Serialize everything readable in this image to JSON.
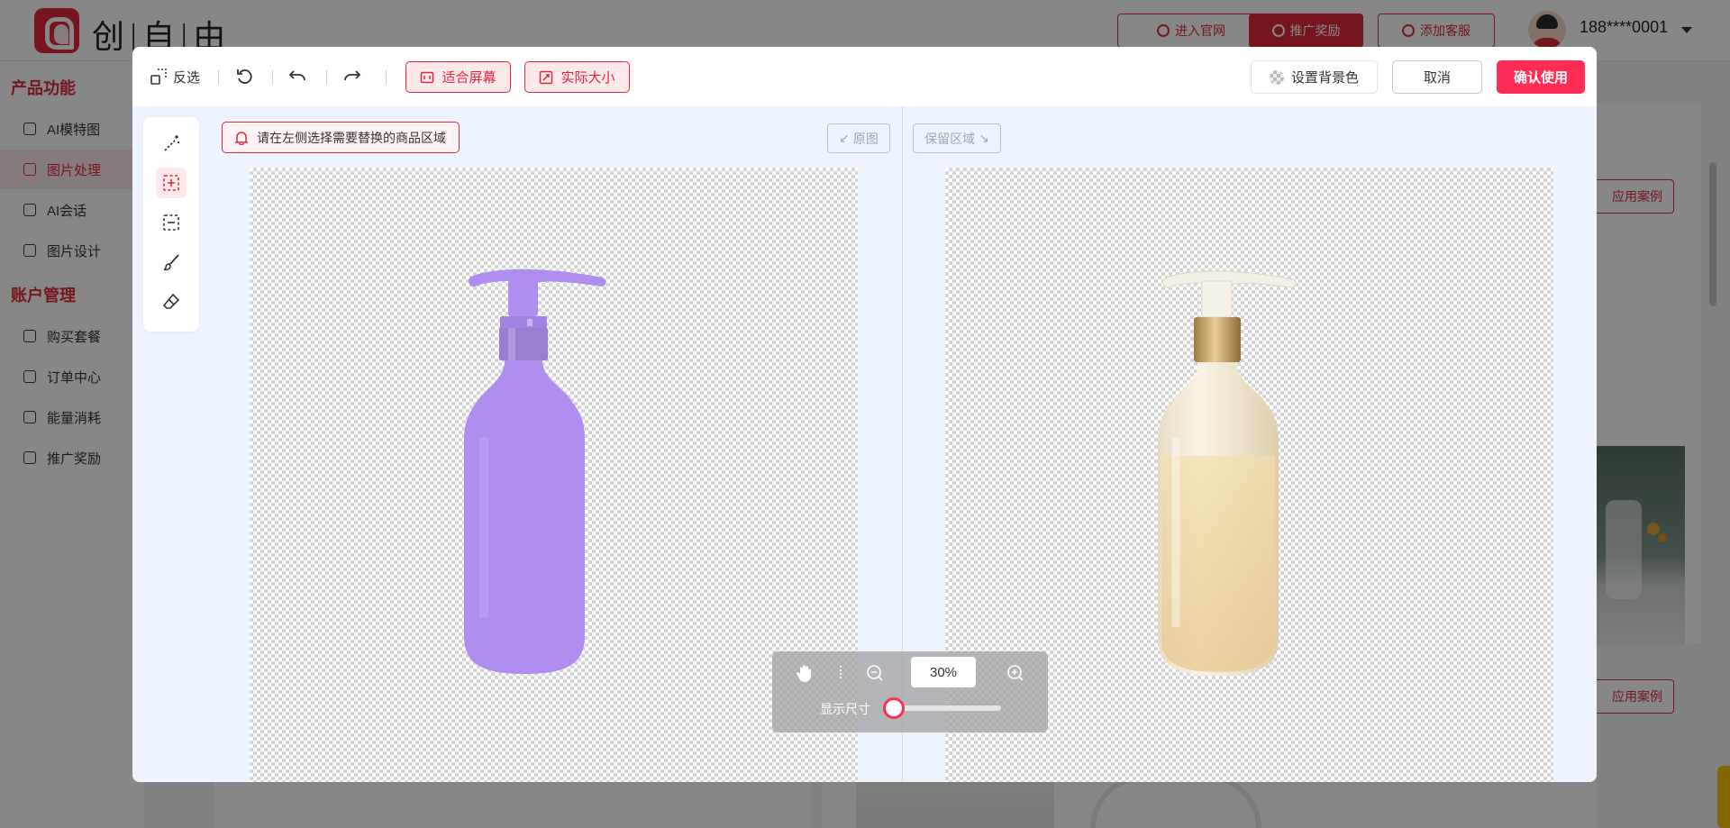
{
  "app": {
    "brand": "创|自|由",
    "header_buttons": [
      {
        "label": "进入官网"
      },
      {
        "label": "推广奖励"
      },
      {
        "label": "添加客服"
      }
    ],
    "user": "188****0001"
  },
  "sidebar": {
    "group1": "产品功能",
    "group1_items": [
      {
        "label": "AI模特图"
      },
      {
        "label": "图片处理"
      },
      {
        "label": "AI会话"
      },
      {
        "label": "图片设计"
      }
    ],
    "group2": "账户管理",
    "group2_items": [
      {
        "label": "购买套餐"
      },
      {
        "label": "订单中心"
      },
      {
        "label": "能量消耗"
      },
      {
        "label": "推广奖励"
      }
    ]
  },
  "page": {
    "case_button": "应用案例"
  },
  "modal": {
    "toolbar": {
      "invert": "反选",
      "fit_screen": "适合屏幕",
      "actual_size": "实际大小",
      "set_bg": "设置背景色",
      "cancel": "取消",
      "confirm": "确认使用"
    },
    "hint": "请在左侧选择需要替换的商品区域",
    "original": "原图",
    "keep_area": "保留区域",
    "zoom": {
      "value": "30%",
      "size_label": "显示尺寸",
      "display_size_level": 0
    },
    "colors": {
      "accent": "#e0283c",
      "confirm": "#ff2d55",
      "mask": "#b08ef0",
      "cap_gold": "#c9a46c",
      "bottle_cream": "#eee0c6"
    }
  }
}
